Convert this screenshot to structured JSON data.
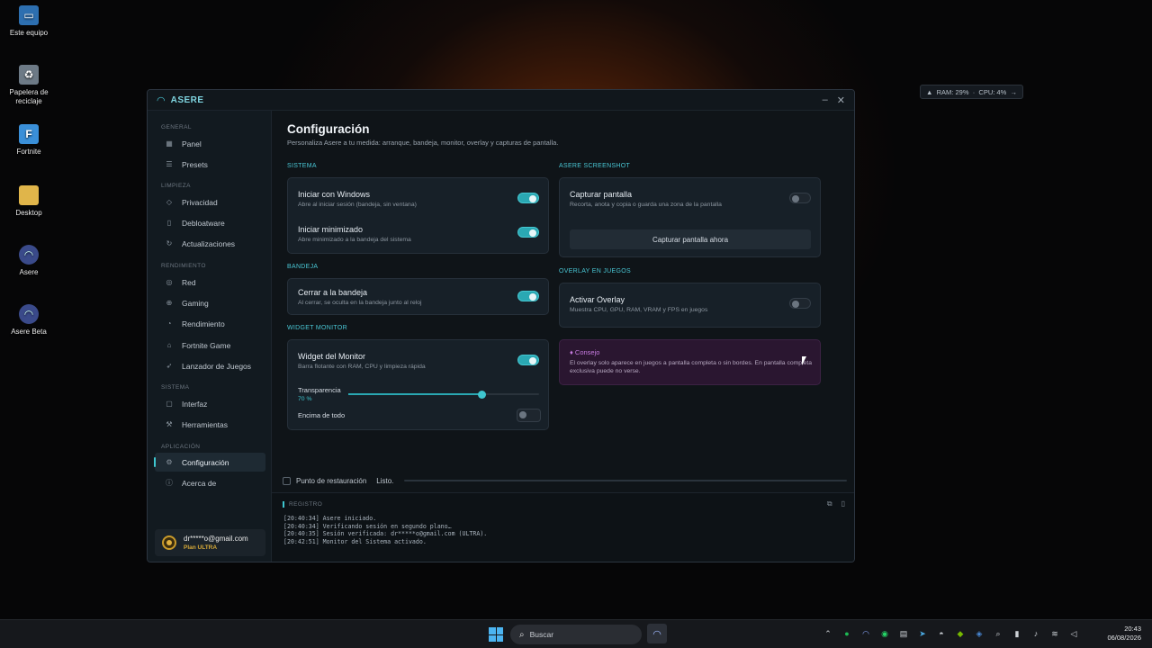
{
  "desktop": {
    "icons": [
      {
        "label": "Este equipo",
        "icon": "computer-icon"
      },
      {
        "label": "Papelera de reciclaje",
        "icon": "recycle-bin-icon"
      },
      {
        "label": "Fortnite",
        "icon": "fortnite-icon"
      },
      {
        "label": "Desktop",
        "icon": "folder-icon"
      },
      {
        "label": "Asere",
        "icon": "asere-icon"
      },
      {
        "label": "Asere Beta",
        "icon": "asere-beta-icon"
      }
    ],
    "mini_monitor": {
      "ram": "RAM: 29%",
      "sep": "·",
      "cpu": "CPU: 4%"
    }
  },
  "window": {
    "app_name": "ASERE",
    "controls": {
      "minimize": "–",
      "close": "✕"
    }
  },
  "sidebar": {
    "sections": {
      "general": "GENERAL",
      "limpieza": "LIMPIEZA",
      "rendimiento": "RENDIMIENTO",
      "sistema": "SISTEMA",
      "aplicacion": "APLICACIÓN"
    },
    "items": {
      "panel": "Panel",
      "presets": "Presets",
      "privacidad": "Privacidad",
      "debloatware": "Debloatware",
      "actualizaciones": "Actualizaciones",
      "red": "Red",
      "gaming": "Gaming",
      "rendimiento": "Rendimiento",
      "fortnite": "Fortnite Game",
      "lanzador": "Lanzador de Juegos",
      "interfaz": "Interfaz",
      "herramientas": "Herramientas",
      "configuracion": "Configuración",
      "acerca": "Acerca de"
    },
    "user": {
      "email": "dr*****o@gmail.com",
      "plan": "Plan ULTRA"
    }
  },
  "main": {
    "title": "Configuración",
    "subtitle": "Personaliza Asere a tu medida: arranque, bandeja, monitor, overlay y capturas de pantalla.",
    "sistema": {
      "label": "SISTEMA",
      "iniciar_windows": {
        "title": "Iniciar con Windows",
        "desc": "Abre al iniciar sesión (bandeja, sin ventana)",
        "on": true
      },
      "iniciar_min": {
        "title": "Iniciar minimizado",
        "desc": "Abre minimizado a la bandeja del sistema",
        "on": true
      }
    },
    "bandeja": {
      "label": "BANDEJA",
      "cerrar": {
        "title": "Cerrar a la bandeja",
        "desc": "Al cerrar, se oculta en la bandeja junto al reloj",
        "on": true
      }
    },
    "widget": {
      "label": "WIDGET MONITOR",
      "monitor": {
        "title": "Widget del Monitor",
        "desc": "Barra flotante con RAM, CPU y limpieza rápida",
        "on": true
      },
      "transparencia": {
        "label": "Transparencia",
        "value_text": "70 %",
        "value": 0.7
      },
      "encima": {
        "label": "Encima de todo",
        "on": false
      }
    },
    "screenshot": {
      "label": "ASERE SCREENSHOT",
      "capturar": {
        "title": "Capturar pantalla",
        "desc": "Recorta, anota y copia o guarda una zona de la pantalla",
        "on": false
      },
      "button": "Capturar pantalla ahora"
    },
    "overlay": {
      "label": "OVERLAY EN JUEGOS",
      "activar": {
        "title": "Activar Overlay",
        "desc": "Muestra CPU, GPU, RAM, VRAM y FPS en juegos",
        "on": false
      }
    },
    "tip": {
      "title": "Consejo",
      "text": "El overlay solo aparece en juegos a pantalla completa o sin bordes. En pantalla completa exclusiva puede no verse."
    }
  },
  "bottom": {
    "restore_point": "Punto de restauración",
    "status": "Listo."
  },
  "log": {
    "header": "REGISTRO",
    "lines": [
      "[20:40:34] Asere iniciado.",
      "[20:40:34] Verificando sesión en segundo plano…",
      "[20:40:35] Sesión verificada: dr*****o@gmail.com (ULTRA).",
      "[20:42:51] Monitor del Sistema activado."
    ]
  },
  "taskbar": {
    "search_placeholder": "Buscar",
    "time": "20:43",
    "date": "06/08/2026"
  },
  "colors": {
    "accent": "#3ec6cf",
    "tip_bg": "#2a1630",
    "gold": "#d5a838"
  }
}
